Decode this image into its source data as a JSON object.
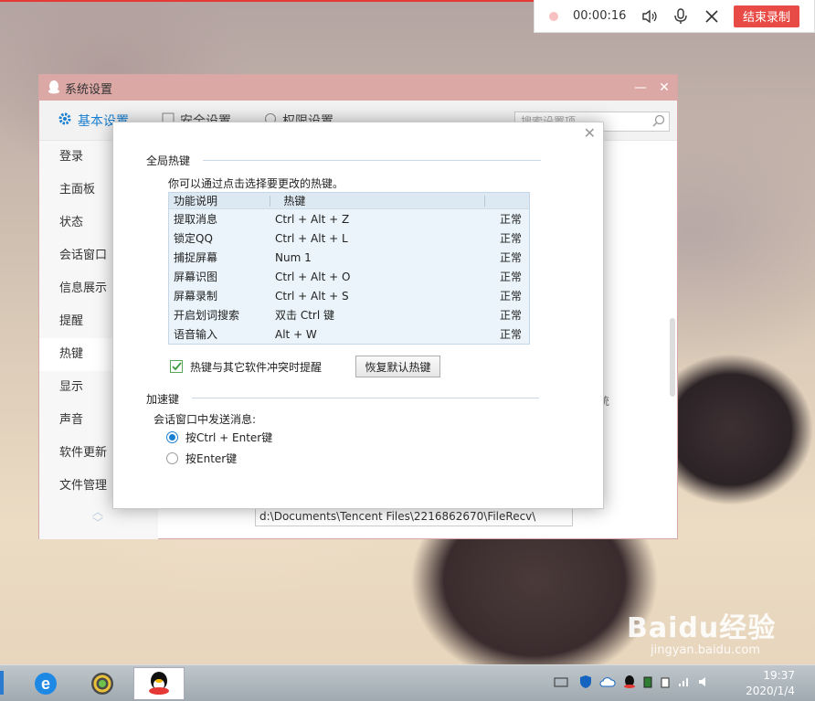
{
  "recorder": {
    "time": "00:00:16",
    "end_label": "结束录制"
  },
  "window": {
    "title": "系统设置",
    "tabs": [
      {
        "label": "基本设置"
      },
      {
        "label": "安全设置"
      },
      {
        "label": "权限设置"
      }
    ],
    "search_placeholder": "搜索设置项",
    "sidebar": [
      {
        "label": "登录"
      },
      {
        "label": "主面板"
      },
      {
        "label": "状态"
      },
      {
        "label": "会话窗口"
      },
      {
        "label": "信息展示"
      },
      {
        "label": "提醒"
      },
      {
        "label": "热键"
      },
      {
        "label": "显示"
      },
      {
        "label": "声音"
      },
      {
        "label": "软件更新"
      },
      {
        "label": "文件管理"
      }
    ],
    "file_path": "d:\\Documents\\Tencent Files\\2216862670\\FileRecv\\",
    "bg_fragment": "统"
  },
  "dialog": {
    "global_hotkeys": {
      "title": "全局热键",
      "hint": "你可以通过点击选择要更改的热键。",
      "columns": [
        "功能说明",
        "热键",
        ""
      ],
      "rows": [
        {
          "func": "提取消息",
          "key": "Ctrl + Alt + Z",
          "status": "正常"
        },
        {
          "func": "锁定QQ",
          "key": "Ctrl + Alt + L",
          "status": "正常"
        },
        {
          "func": "捕捉屏幕",
          "key": "Num 1",
          "status": "正常"
        },
        {
          "func": "屏幕识图",
          "key": "Ctrl + Alt + O",
          "status": "正常"
        },
        {
          "func": "屏幕录制",
          "key": "Ctrl + Alt + S",
          "status": "正常"
        },
        {
          "func": "开启划词搜索",
          "key": "双击 Ctrl 键",
          "status": "正常"
        },
        {
          "func": "语音输入",
          "key": "Alt + W",
          "status": "正常"
        }
      ],
      "conflict_checkbox": {
        "label": "热键与其它软件冲突时提醒",
        "checked": true
      },
      "restore_button": "恢复默认热键"
    },
    "accelerator": {
      "title": "加速键",
      "subtitle": "会话窗口中发送消息:",
      "options": [
        {
          "label": "按Ctrl + Enter键",
          "selected": true
        },
        {
          "label": "按Enter键",
          "selected": false
        }
      ]
    }
  },
  "taskbar": {
    "clock_time": "19:37",
    "clock_date": "2020/1/4"
  },
  "watermark": {
    "logo": "Baidu经验",
    "url": "jingyan.baidu.com"
  }
}
